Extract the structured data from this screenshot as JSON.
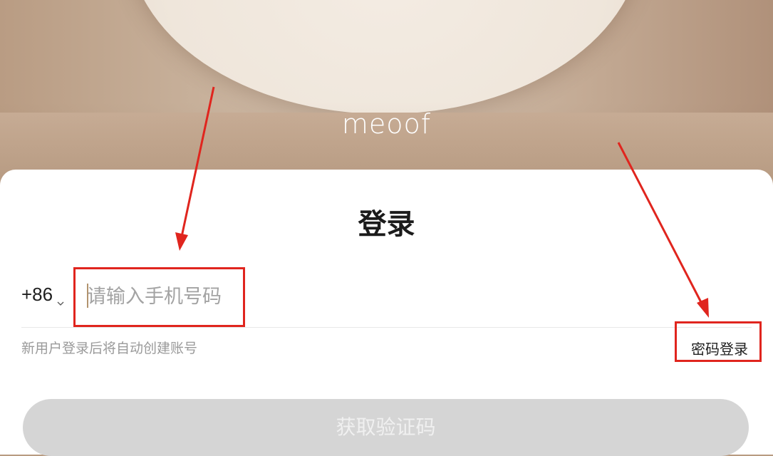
{
  "header": {
    "logo_text": "meoof"
  },
  "login": {
    "title": "登录",
    "country_code": "+86",
    "phone_placeholder": "请输入手机号码",
    "phone_value": "",
    "hint": "新用户登录后将自动创建账号",
    "password_login_link": "密码登录",
    "submit_label": "获取验证码"
  },
  "colors": {
    "accent_red": "#e0251e",
    "button_disabled": "#d5d5d5",
    "hero_tan": "#c1a58c"
  },
  "icons": {
    "country_dropdown": "chevron-down-icon"
  }
}
